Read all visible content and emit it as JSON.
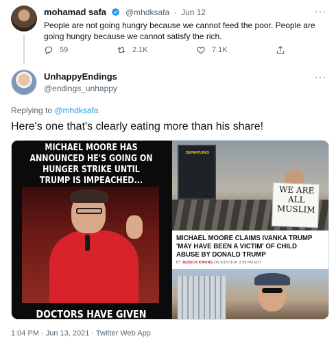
{
  "parent_tweet": {
    "display_name": "mohamad safa",
    "handle": "@mhdksafa",
    "separator": "·",
    "date": "Jun 12",
    "text": "People are not going hungry because we cannot feed the poor. People are going hungry because we cannot satisfy the rich.",
    "more": "···",
    "actions": {
      "replies": "59",
      "retweets": "2.1K",
      "likes": "7.1K"
    },
    "accent_color": "#1d9bf0"
  },
  "reply_tweet": {
    "display_name": "UnhappyEndings",
    "handle": "@endings_unhappy",
    "more": "···",
    "replying_prefix": "Replying to ",
    "replying_to": "@mhdksafa",
    "text": "Here's one that's clearly eating more than his share!",
    "timestamp": "1:04 PM · Jun 13, 2021 · Twitter Web App"
  },
  "media": {
    "meme_top": "MICHAEL MOORE HAS ANNOUNCED HE'S GOING ON HUNGER STRIKE UNTIL TRUMP IS IMPEACHED...",
    "meme_bottom": "DOCTORS HAVE GIVEN",
    "departures_label": "DEPARTURES",
    "sign_text": "WE ARE ALL MUSLIM",
    "headline": "MICHAEL MOORE CLAIMS IVANKA TRUMP 'MAY HAVE BEEN A VICTIM' OF CHILD ABUSE BY DONALD TRUMP",
    "byline_prefix": "BY ",
    "byline_author": "JESSICA KWONG",
    "byline_suffix": " ON 9/10/18 AT 2:58 PM EDT"
  }
}
